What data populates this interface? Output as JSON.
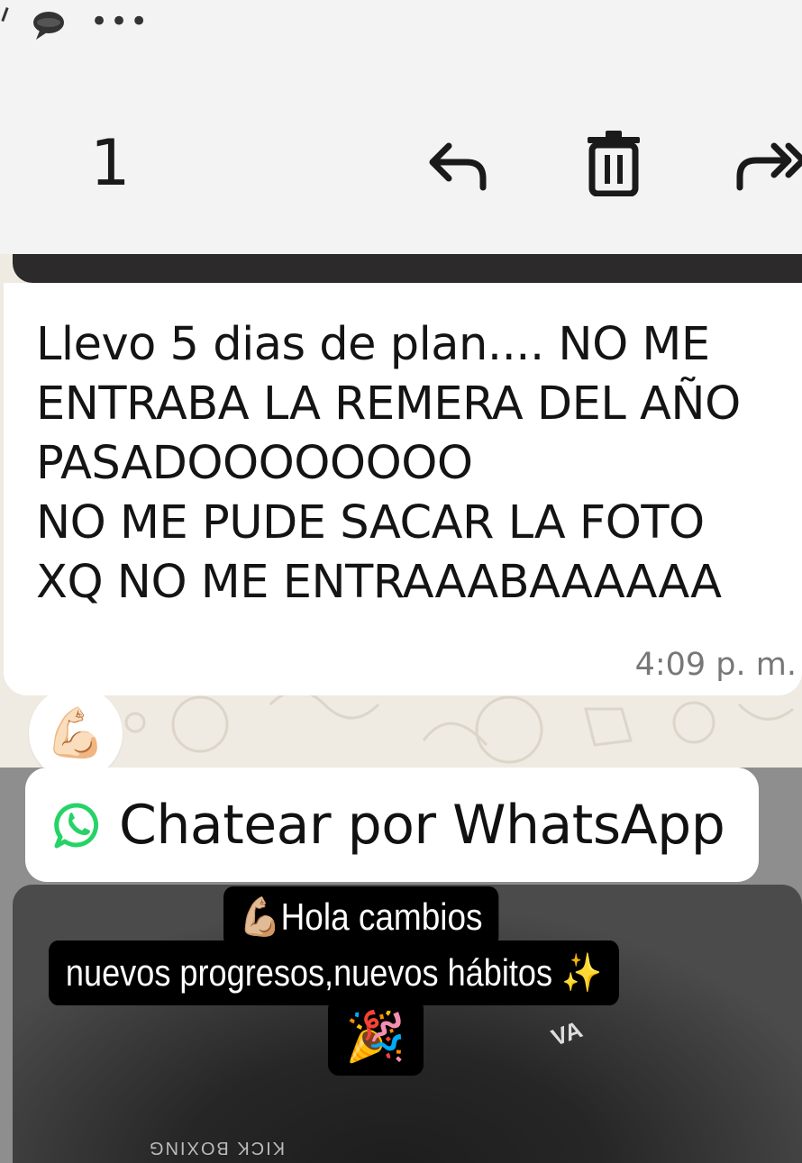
{
  "status_bar": {
    "icons": [
      "chat-bubble-icon",
      "more-dots-icon"
    ],
    "more_glyph": "•••"
  },
  "action_bar": {
    "selected_count": "1",
    "icons": [
      "reply-icon",
      "delete-icon",
      "forward-icon"
    ]
  },
  "message": {
    "text": "Llevo 5 dias de plan.... NO ME\nENTRABA LA REMERA DEL AÑO\nPASADOOOOOOOO\nNO ME PUDE SACAR LA FOTO\nXQ NO ME ENTRAAABAAAAAA",
    "time": "4:09 p. m.",
    "reaction": "💪🏻"
  },
  "cta": {
    "label": "Chatear por WhatsApp",
    "icon": "whatsapp-icon",
    "color": "#25D366"
  },
  "story": {
    "caption_line1": "💪🏼Hola cambios",
    "caption_line2": "nuevos progresos,nuevos hábitos ✨",
    "caption_line3": "🎉"
  }
}
